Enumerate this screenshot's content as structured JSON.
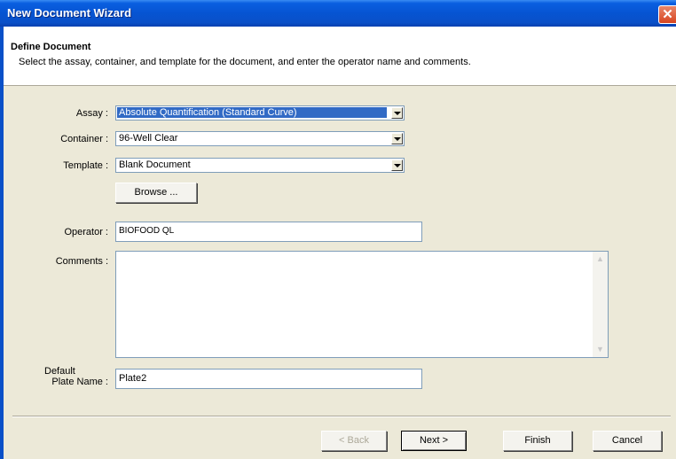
{
  "window": {
    "title": "New Document Wizard",
    "close_glyph": "✕"
  },
  "header": {
    "title": "Define Document",
    "subtitle": "Select the assay, container, and template for the document, and enter the operator name and comments."
  },
  "form": {
    "assay": {
      "label": "Assay :",
      "value": "Absolute Quantification (Standard Curve)"
    },
    "container": {
      "label": "Container :",
      "value": "96-Well Clear"
    },
    "template": {
      "label": "Template :",
      "value": "Blank Document"
    },
    "browse_label": "Browse ...",
    "operator": {
      "label": "Operator :",
      "value": "BIOFOOD QL"
    },
    "comments": {
      "label": "Comments :",
      "value": ""
    },
    "plate_name": {
      "label_line1": "Default",
      "label_line2": "Plate Name :",
      "value": "Plate2"
    }
  },
  "buttons": {
    "back": "< Back",
    "next": "Next >",
    "finish": "Finish",
    "cancel": "Cancel"
  },
  "icons": {
    "scroll_up": "▲",
    "scroll_down": "▼"
  }
}
